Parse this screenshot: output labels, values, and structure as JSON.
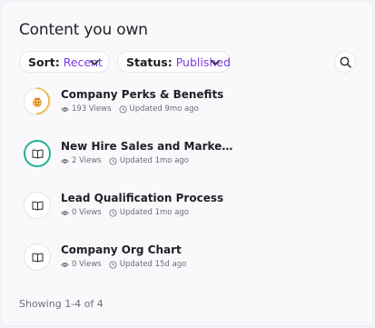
{
  "header": {
    "title": "Content you own"
  },
  "filters": {
    "sort_label": "Sort:",
    "sort_value": "Recent",
    "status_label": "Status:",
    "status_value": "Published"
  },
  "items": [
    {
      "name": "Company Perks & Benefits",
      "views": "193 Views",
      "updated": "Updated 9mo ago",
      "icon": "gift-emoji-icon",
      "progress": 0.5
    },
    {
      "name": "New Hire Sales and Marketing Trai...",
      "views": "2 Views",
      "updated": "Updated 1mo ago",
      "icon": "book-icon",
      "progress": 1.0
    },
    {
      "name": "Lead Qualification Process",
      "views": "0 Views",
      "updated": "Updated 1mo ago",
      "icon": "book-icon",
      "progress": 0
    },
    {
      "name": "Company Org Chart",
      "views": "0 Views",
      "updated": "Updated 15d ago",
      "icon": "book-icon",
      "progress": 0
    }
  ],
  "footer": {
    "text": "Showing 1-4 of 4"
  },
  "colors": {
    "accent": "#7a3be0",
    "teal": "#24b096",
    "gold": "#e9b53b"
  }
}
